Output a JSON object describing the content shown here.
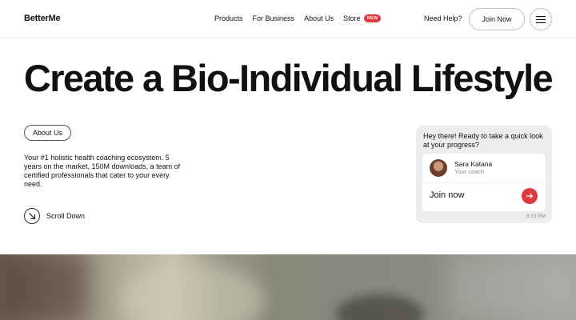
{
  "header": {
    "logo": "BetterMe",
    "nav": {
      "products": "Products",
      "for_business": "For Business",
      "about_us": "About Us",
      "store": "Store",
      "store_badge": "NEW"
    },
    "help": "Need Help?",
    "join_label": "Join Now",
    "menu_icon": "hamburger-menu-icon"
  },
  "hero": {
    "title": "Create a Bio-Individual Lifestyle",
    "about_pill": "About Us",
    "description": "Your #1 holistic health coaching ecosystem. 5 years on the market, 150M downloads, a team of certified professionals that cater to your every need.",
    "scroll_label": "Scroll Down",
    "scroll_icon": "arrow-down-right-icon"
  },
  "chat": {
    "message": "Hey there! Ready to take a quick look at your progress?",
    "coach_name": "Sara Katana",
    "coach_role": "Your coach",
    "cta": "Join now",
    "cta_icon": "arrow-right-icon",
    "time": "8:10 PM"
  },
  "colors": {
    "accent": "#e0393e",
    "chat_bg": "#ededf0",
    "text": "#111111"
  }
}
